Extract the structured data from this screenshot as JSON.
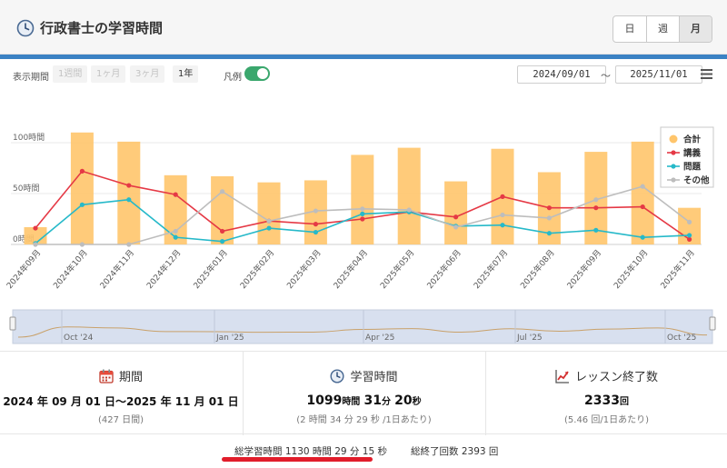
{
  "header": {
    "title": "行政書士の学習時間",
    "periods": [
      "日",
      "週",
      "月"
    ],
    "active_period": 2
  },
  "toolbar": {
    "range_label": "表示期間",
    "range_buttons": [
      "1週間",
      "1ヶ月",
      "3ヶ月",
      "1年"
    ],
    "active_range": 3,
    "legend_label": "凡例",
    "legend_on": true,
    "start_date": "2024/09/01",
    "separator": "〜",
    "end_date": "2025/11/01"
  },
  "colors": {
    "total": "#ffc56b",
    "lecture": "#e53945",
    "problem": "#26b9c9",
    "other": "#bdbdbd",
    "accent": "#3b82c4"
  },
  "chart_data": {
    "type": "bar",
    "categories": [
      "2024年09月",
      "2024年10月",
      "2024年11月",
      "2024年12月",
      "2025年01月",
      "2025年02月",
      "2025年03月",
      "2025年04月",
      "2025年05月",
      "2025年06月",
      "2025年07月",
      "2025年08月",
      "2025年09月",
      "2025年10月",
      "2025年11月"
    ],
    "series": [
      {
        "name": "合計",
        "kind": "bar",
        "values": [
          17,
          110,
          101,
          68,
          67,
          61,
          63,
          88,
          95,
          62,
          94,
          71,
          91,
          101,
          36
        ]
      },
      {
        "name": "講義",
        "kind": "line",
        "values": [
          16,
          72,
          58,
          49,
          13,
          23,
          20,
          25,
          32,
          27,
          47,
          36,
          36,
          37,
          5
        ]
      },
      {
        "name": "問題",
        "kind": "line",
        "values": [
          1,
          39,
          44,
          7,
          3,
          16,
          12,
          30,
          32,
          18,
          19,
          11,
          14,
          7,
          9
        ]
      },
      {
        "name": "その他",
        "kind": "line",
        "values": [
          0,
          0,
          0,
          13,
          52,
          23,
          33,
          35,
          34,
          17,
          29,
          26,
          44,
          57,
          22
        ]
      }
    ],
    "y_ticks": [
      {
        "value": 0,
        "label": "0時間"
      },
      {
        "value": 50,
        "label": "50時間"
      },
      {
        "value": 100,
        "label": "100時間"
      }
    ],
    "ylim": [
      0,
      120
    ],
    "grid": true,
    "legend_position": "top-right",
    "navigator_labels": [
      "Oct '24",
      "Jan '25",
      "Apr '25",
      "Jul '25",
      "Oct '25"
    ]
  },
  "stats": {
    "period": {
      "title": "期間",
      "value": "2024 年 09 月 01 日〜2025 年 11 月 01 日",
      "sub": "(427 日間)"
    },
    "study": {
      "title": "学習時間",
      "hours": "1099",
      "h_unit": "時間",
      "minutes": "31",
      "m_unit": "分",
      "seconds": "20",
      "s_unit": "秒",
      "sub": "(2 時間 34 分 29 秒 /1日あたり)"
    },
    "lessons": {
      "title": "レッスン終了数",
      "value": "2333",
      "unit": "回",
      "sub": "(5.46 回/1日あたり)"
    }
  },
  "footer": {
    "total_time": "総学習時間 1130 時間 29 分 15 秒",
    "total_count": "総終了回数 2393 回"
  }
}
